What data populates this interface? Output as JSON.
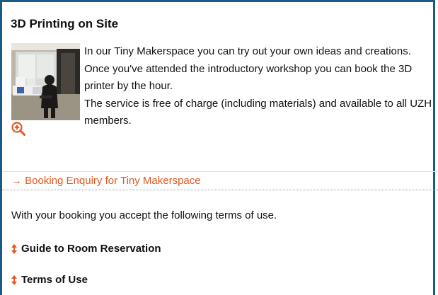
{
  "section": {
    "title": "3D Printing on Site"
  },
  "intro": {
    "paragraph1": "In our Tiny Makerspace you can try out your own ideas and creations. Once you've attended the introductory workshop you can book the 3D printer by the hour.",
    "paragraph2": "The service is free of charge (including materials) and available to all UZH members."
  },
  "booking": {
    "link_label": "→ Booking Enquiry for Tiny Makerspace"
  },
  "terms_note": "With your booking you accept the following terms of use.",
  "accordion": [
    {
      "label": "Guide to Room Reservation",
      "icon": "up-down-arrows-icon"
    },
    {
      "label": "Terms of Use",
      "icon": "up-down-arrows-icon"
    }
  ],
  "colors": {
    "frame": "#1b5a86",
    "accent": "#e4571d",
    "text": "#111111"
  }
}
